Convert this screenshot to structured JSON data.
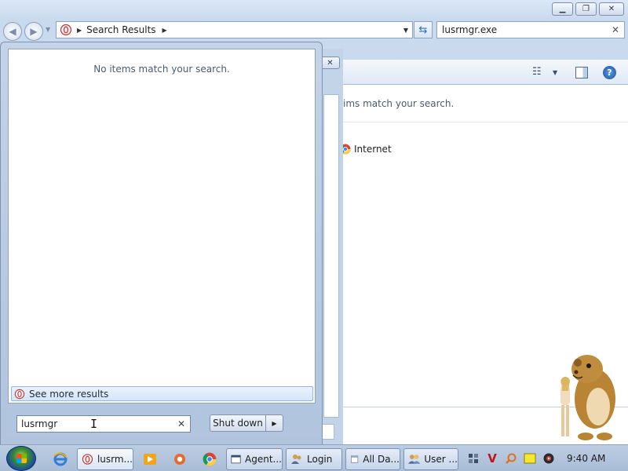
{
  "explorer": {
    "address": {
      "location": "Search Results"
    },
    "search": {
      "value": "lusrmgr.exe"
    },
    "content": {
      "message": "ims match your search.",
      "search_again_item": "Internet"
    }
  },
  "start_menu": {
    "results_message": "No items match your search.",
    "see_more_label": "See more results",
    "search_value": "lusrmgr",
    "shutdown_label": "Shut down"
  },
  "taskbar": {
    "buttons": [
      {
        "label": "lusrm..."
      },
      {
        "label": "Agent..."
      },
      {
        "label": "Login"
      },
      {
        "label": "All Da..."
      },
      {
        "label": "User ..."
      }
    ],
    "clock": "9:40 AM"
  },
  "colors": {
    "window_frame": "#c9d9ee",
    "start_menu": "#b8cae2",
    "taskbar": "#b3c5dc",
    "accent_blue": "#1c4f9c"
  }
}
